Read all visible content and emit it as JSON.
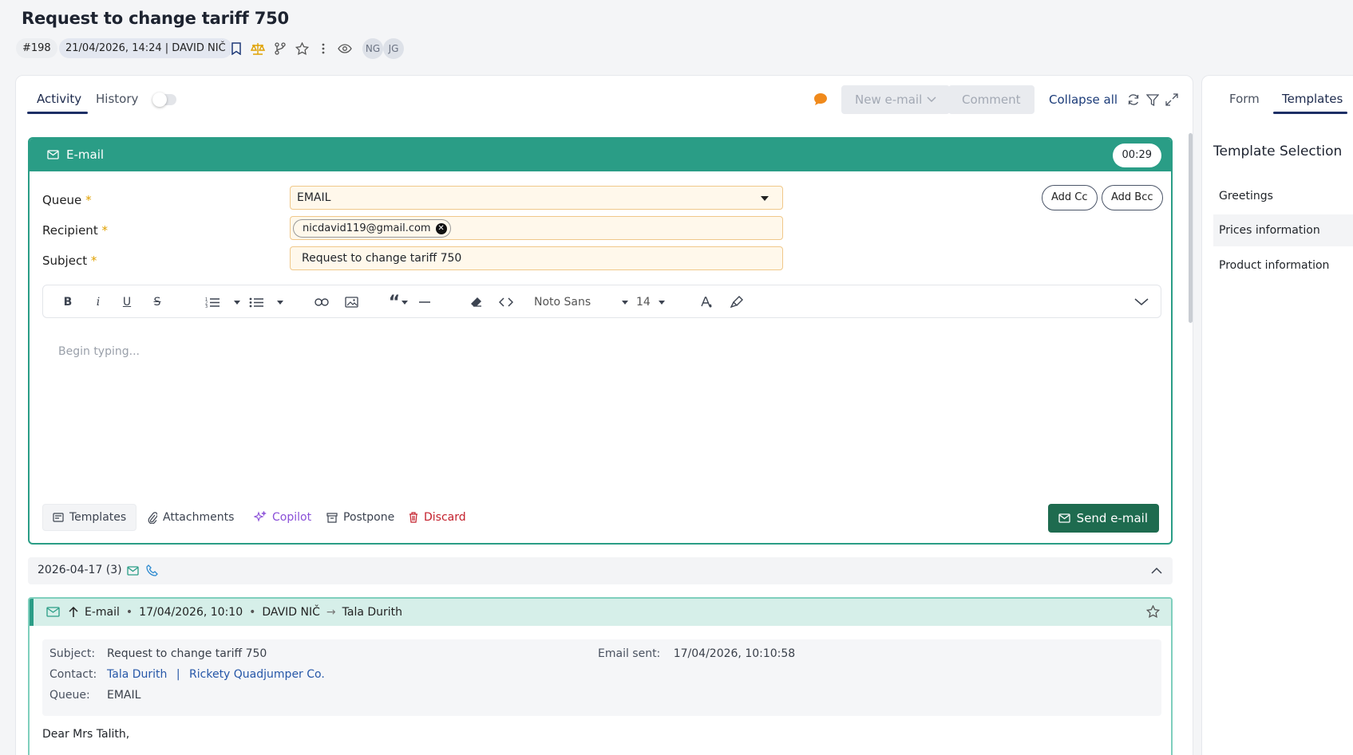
{
  "header": {
    "title": "Request to change tariff 750",
    "ticket_id": "#198",
    "created": "21/04/2026, 14:24 | DAVID NIČ",
    "avatars": [
      "NG",
      "JG"
    ]
  },
  "activity_tabs": {
    "activity": "Activity",
    "history": "History"
  },
  "actions": {
    "new_email": "New e-mail",
    "comment": "Comment",
    "collapse_all": "Collapse all"
  },
  "composer": {
    "title": "E-mail",
    "timer": "00:29",
    "queue_label": "Queue",
    "queue_value": "EMAIL",
    "recipient_label": "Recipient",
    "recipient_chip": "nicdavid119@gmail.com",
    "subject_label": "Subject",
    "subject_value": "Request to change tariff 750",
    "add_cc": "Add Cc",
    "add_bcc": "Add Bcc",
    "required_mark": "*",
    "toolbar": {
      "font": "Noto Sans",
      "size": "14"
    },
    "body_placeholder": "Begin typing...",
    "footer": {
      "templates": "Templates",
      "attachments": "Attachments",
      "copilot": "Copilot",
      "postpone": "Postpone",
      "discard": "Discard",
      "send": "Send e-mail"
    }
  },
  "timeline": {
    "day_label": "2026-04-17 (3)",
    "entry": {
      "type": "E-mail",
      "datetime": "17/04/2026, 10:10",
      "from": "DAVID NIČ",
      "to": "Tala Durith",
      "subject_label": "Subject:",
      "subject_value": "Request to change tariff 750",
      "sent_label": "Email sent:",
      "sent_value": "17/04/2026, 10:10:58",
      "contact_label": "Contact:",
      "contact_person": "Tala Durith",
      "separator": "|",
      "contact_company": "Rickety Quadjumper Co.",
      "queue_label": "Queue:",
      "queue_value": "EMAIL",
      "greeting": "Dear Mrs Talith,"
    }
  },
  "side": {
    "tabs": {
      "form": "Form",
      "templates": "Templates"
    },
    "title": "Template Selection",
    "templates": [
      "Greetings",
      "Prices information",
      "Product information"
    ]
  },
  "colors": {
    "accent": "#2a9d86",
    "send": "#1e6b4f",
    "link": "#2657a8",
    "copilot": "#8a4fd8",
    "discard": "#c4202c"
  }
}
